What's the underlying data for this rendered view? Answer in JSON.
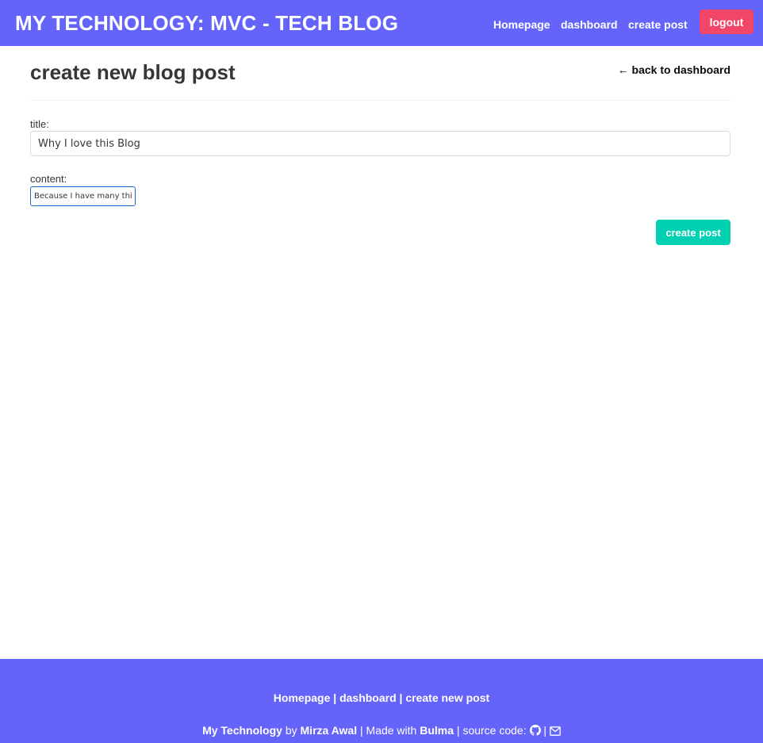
{
  "navbar": {
    "brand": "MY TECHNOLOGY: MVC - TECH BLOG",
    "links": [
      {
        "label": "Homepage"
      },
      {
        "label": "dashboard"
      },
      {
        "label": "create post"
      }
    ],
    "logout_label": "logout"
  },
  "main": {
    "title": "create new blog post",
    "back_link": "← back to dashboard",
    "form": {
      "title_label": "title:",
      "title_value": "Why I love this Blog",
      "content_label": "content:",
      "content_value": "Because I have many things",
      "submit_label": "create post"
    }
  },
  "footer": {
    "links": [
      "Homepage",
      "dashboard",
      "create new post"
    ],
    "separator": "|",
    "credit": {
      "app_name": "My Technology",
      "by_text": "by",
      "author": "Mirza Awal",
      "made_with_text": "| Made with",
      "framework": "Bulma",
      "source_text": "| source code:",
      "pipe": "|"
    },
    "icons": [
      "github-icon",
      "email-icon"
    ]
  },
  "colors": {
    "navbar_bg": "#6464fa",
    "danger": "#f14668",
    "primary": "#00d1b2",
    "text": "#363636"
  }
}
